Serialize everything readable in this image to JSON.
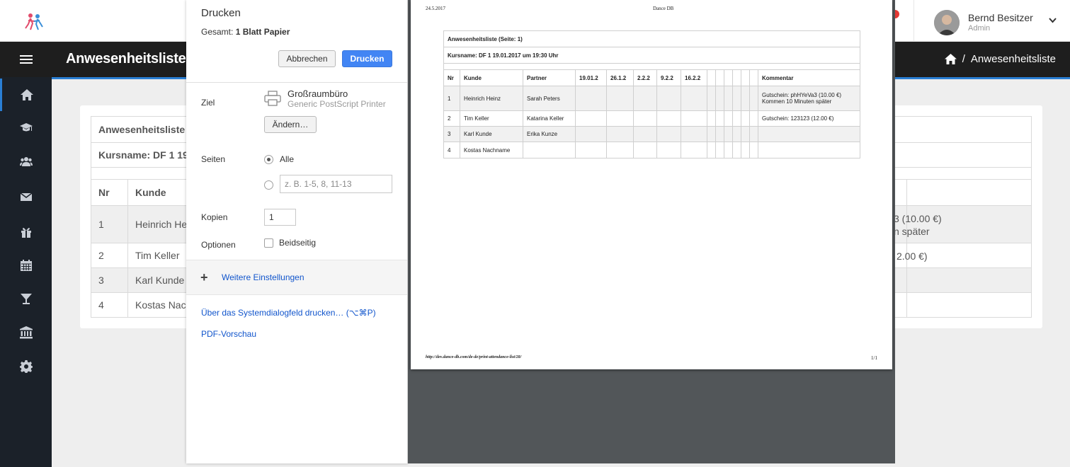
{
  "app": {
    "user": {
      "name": "Bernd Besitzer",
      "role": "Admin"
    },
    "page_title": "Anwesenheitsliste",
    "breadcrumb": {
      "current": "Anwesenheitsliste",
      "separator": "/"
    },
    "accent_color": "#2a7fd4",
    "sidebar_icons": [
      "home-icon",
      "graduation-cap-icon",
      "users-icon",
      "envelope-icon",
      "gift-icon",
      "calendar-icon",
      "cocktail-icon",
      "bank-icon",
      "gear-icon"
    ]
  },
  "background_table": {
    "title": "Anwesenheitsliste (",
    "kurs": "Kursname: DF 1 19.0",
    "headers": [
      "Nr",
      "Kunde"
    ],
    "rows": [
      {
        "nr": "1",
        "kunde": "Heinrich Hei",
        "right_line1": "3 (10.00 €)",
        "right_line2": "n später"
      },
      {
        "nr": "2",
        "kunde": "Tim Keller",
        "right_line1": "2.00 €)",
        "right_line2": ""
      },
      {
        "nr": "3",
        "kunde": "Karl Kunde",
        "right_line1": "",
        "right_line2": ""
      },
      {
        "nr": "4",
        "kunde": "Kostas Nach",
        "right_line1": "",
        "right_line2": ""
      }
    ]
  },
  "print_dialog": {
    "title": "Drucken",
    "total_label": "Gesamt:",
    "total_value": "1 Blatt Papier",
    "cancel_label": "Abbrechen",
    "print_label": "Drucken",
    "destination_label": "Ziel",
    "printer_name": "Großraumbüro",
    "printer_desc": "Generic PostScript Printer",
    "change_label": "Ändern…",
    "pages_label": "Seiten",
    "pages_all_label": "Alle",
    "pages_placeholder": "z. B. 1-5, 8, 11-13",
    "copies_label": "Kopien",
    "copies_value": "1",
    "options_label": "Optionen",
    "duplex_label": "Beidseitig",
    "more_settings_label": "Weitere Einstellungen",
    "system_dialog_link": "Über das Systemdialogfeld drucken… (⌥⌘P)",
    "pdf_preview_link": "PDF-Vorschau",
    "primary_color": "#4285f4",
    "link_color": "#1155cc"
  },
  "preview_page": {
    "date": "24.5.2017",
    "site": "Dance DB",
    "url": "http://dev.dance-db.com/de-de/print-attendance-list/28/",
    "page_number": "1/1",
    "table": {
      "title": "Anwesenheitsliste (Seite: 1)",
      "kurs": "Kursname: DF 1 19.01.2017 um 19:30 Uhr",
      "headers": [
        "Nr",
        "Kunde",
        "Partner",
        "19.01.2",
        "26.1.2",
        "2.2.2",
        "9.2.2",
        "16.2.2",
        "",
        "",
        "",
        "",
        "",
        "",
        "Kommentar"
      ],
      "rows": [
        {
          "nr": "1",
          "kunde": "Heinrich Heinz",
          "partner": "Sarah Peters",
          "comment1": "Gutschein: phHYeVa3 (10.00 €)",
          "comment2": "Kommen 10 Minuten später"
        },
        {
          "nr": "2",
          "kunde": "Tim Keller",
          "partner": "Katarina Keller",
          "comment1": "Gutschein: 123123 (12.00 €)",
          "comment2": ""
        },
        {
          "nr": "3",
          "kunde": "Karl Kunde",
          "partner": "Erika Kunze",
          "comment1": "",
          "comment2": ""
        },
        {
          "nr": "4",
          "kunde": "Kostas Nachname",
          "partner": "",
          "comment1": "",
          "comment2": ""
        }
      ]
    }
  }
}
